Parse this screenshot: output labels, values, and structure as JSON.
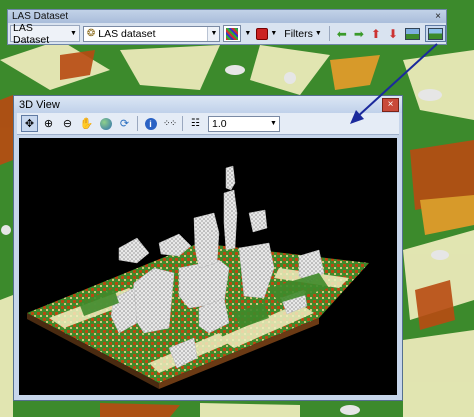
{
  "toolbar": {
    "title": "LAS Dataset",
    "close_glyph": "×",
    "menu_label": "LAS Dataset",
    "dataset_value": "LAS dataset",
    "filters_label": "Filters",
    "icons": [
      "las-dataset-layer-icon",
      "point-symbology-icon",
      "elevation-icon",
      "left-arrow-icon",
      "right-arrow-icon",
      "up-arrow-icon",
      "down-arrow-icon",
      "profile-view-icon",
      "3d-view-icon"
    ]
  },
  "view3d": {
    "title": "3D View",
    "close_glyph": "×",
    "point_size": "1.0",
    "tools": [
      "navigate-icon",
      "zoom-in-icon",
      "zoom-out-icon",
      "pan-icon",
      "full-extent-icon",
      "refresh-icon",
      "info-icon",
      "points-icon",
      "point-size-icon"
    ]
  },
  "colors": {
    "grass": "#3c8a2c",
    "bare": "#b84a12",
    "building": "#e6e6e6",
    "ground": "#f3eec0",
    "arrow": "#1b2a9c"
  }
}
